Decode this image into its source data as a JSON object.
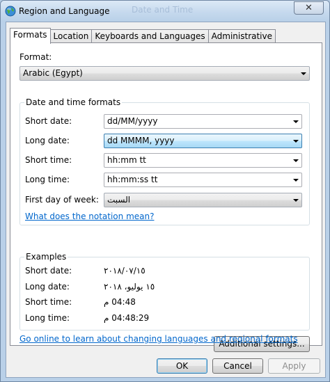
{
  "window": {
    "title": "Region and Language",
    "ghost_title": "Date and Time"
  },
  "tabs": [
    {
      "label": "Formats"
    },
    {
      "label": "Location"
    },
    {
      "label": "Keyboards and Languages"
    },
    {
      "label": "Administrative"
    }
  ],
  "format": {
    "label": "Format:",
    "value": "Arabic (Egypt)"
  },
  "datetime": {
    "title": "Date and time formats",
    "short_date": {
      "label": "Short date:",
      "value": "dd/MM/yyyy"
    },
    "long_date": {
      "label": "Long date:",
      "value": "dd MMMM, yyyy"
    },
    "short_time": {
      "label": "Short time:",
      "value": "hh:mm tt"
    },
    "long_time": {
      "label": "Long time:",
      "value": "hh:mm:ss tt"
    },
    "first_day": {
      "label": "First day of week:",
      "value": "السبت"
    },
    "notation_link": "What does the notation mean?"
  },
  "examples": {
    "title": "Examples",
    "short_date": {
      "label": "Short date:",
      "value": "٢٠١٨/٠٧/١٥"
    },
    "long_date": {
      "label": "Long date:",
      "value": "١٥ يوليو، ٢٠١٨"
    },
    "short_time": {
      "label": "Short time:",
      "value": "04:48 م"
    },
    "long_time": {
      "label": "Long time:",
      "value": "04:48:29 م"
    }
  },
  "additional_settings": "Additional settings...",
  "online_link": "Go online to learn about changing languages and regional formats",
  "buttons": {
    "ok": "OK",
    "cancel": "Cancel",
    "apply": "Apply"
  }
}
